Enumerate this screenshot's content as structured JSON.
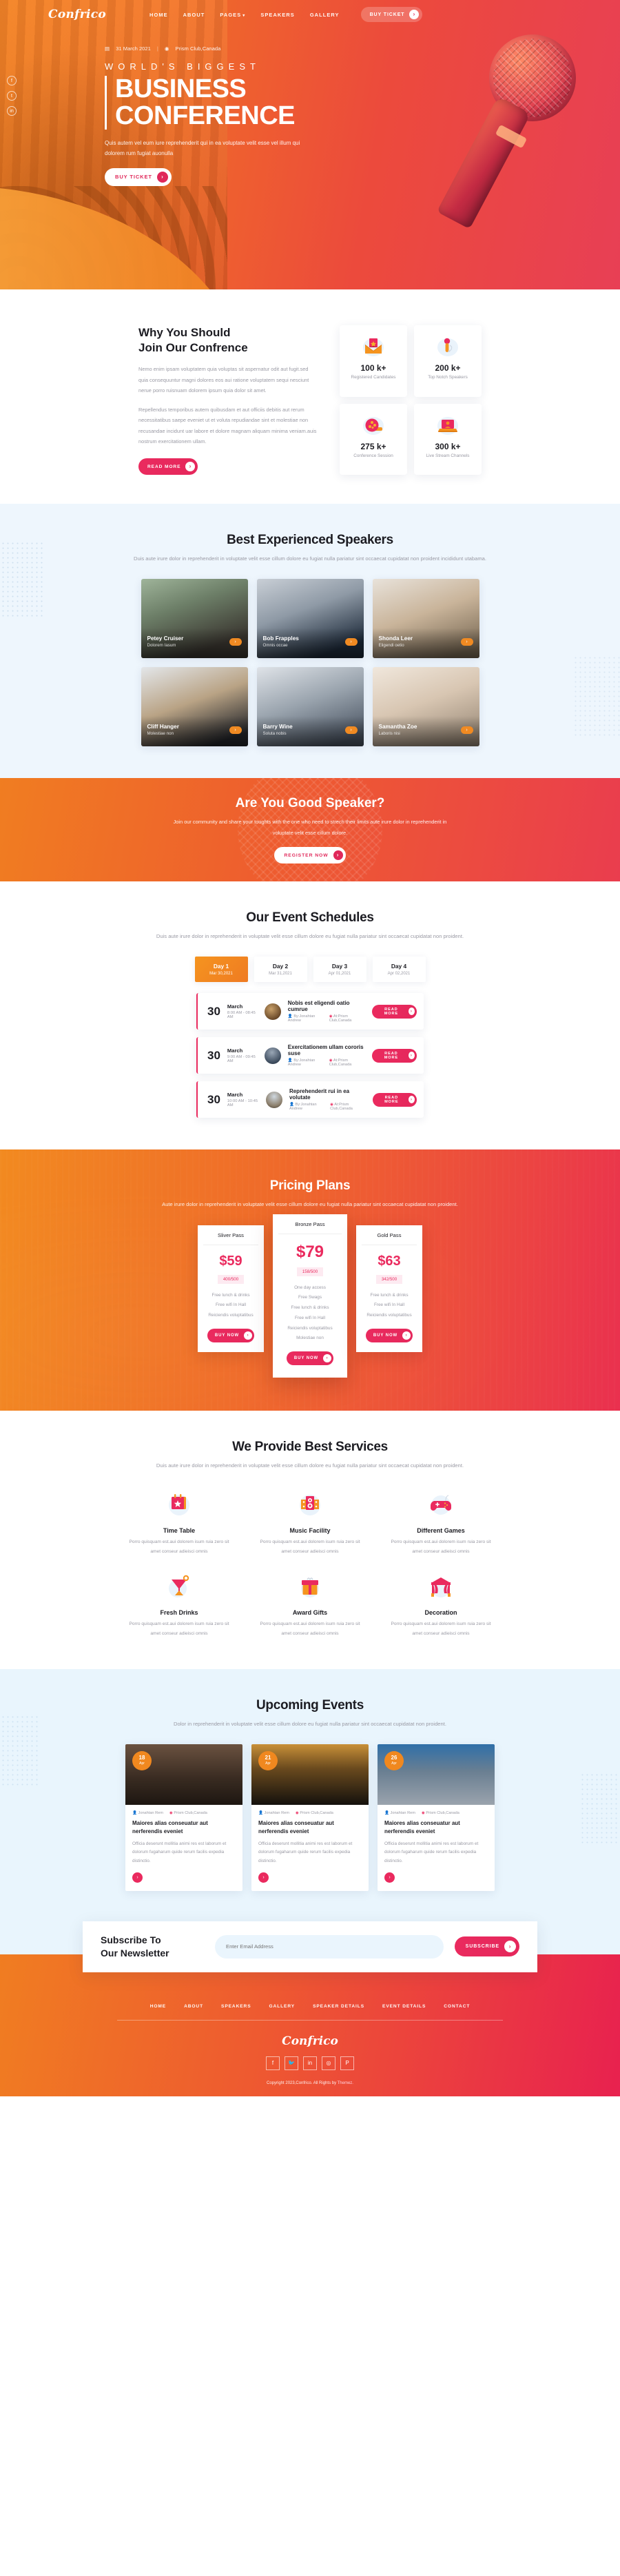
{
  "brand": {
    "name": "Confrico",
    "logo_icon": "confrico-script-logo"
  },
  "nav": {
    "items": [
      {
        "label": "HOME"
      },
      {
        "label": "ABOUT"
      },
      {
        "label": "PAGES"
      },
      {
        "label": "SPEAKERS"
      },
      {
        "label": "GALLERY"
      }
    ],
    "cta": {
      "label": "BUY TICKET",
      "icon": "chevron-right-icon"
    }
  },
  "hero": {
    "social": [
      {
        "icon": "facebook-icon",
        "glyph": "f"
      },
      {
        "icon": "twitter-icon",
        "glyph": "t"
      },
      {
        "icon": "instagram-icon",
        "glyph": "in"
      }
    ],
    "date": "31 March 2021",
    "date_icon": "calendar-icon",
    "location": "Prism Club,Canada",
    "location_icon": "map-pin-icon",
    "pretitle": "WORLD'S BIGGEST",
    "title_line1": "BUSINESS",
    "title_line2": "CONFERENCE",
    "description": "Quis autem vel eum iure reprehenderit qui in ea voluptate velit esse vel illum qui dolorem rum fugiat auonulla",
    "cta": {
      "label": "BUY TICKET",
      "icon": "chevron-right-icon"
    }
  },
  "why": {
    "title_line1": "Why You Should",
    "title_line2": "Join Our Confrence",
    "para1": "Nemo enim ipsam voluptatem quia voluptas sit aspernatur odit aut fugit.sed quia consequuntur magni dolores eos aui ratione voluptatem sequi nesciunt nerue porro ruisnuam dolorem ipsum quia dolor sit amet.",
    "para2": "Repellendus temporibus autem quibusdam et aut officiis debitis aut rerum necessitatibus saepe eveniet ut et voluta repudiandae sint et molestiae non recusandae incidunt uar labore et dolore magnam aliquam minima veniam.auis nostrum exercitationem ullam.",
    "cta": {
      "label": "READ MORE",
      "icon": "chevron-right-icon"
    },
    "stats": [
      {
        "number": "100 k+",
        "label": "Registered Candidates",
        "icon": "envelope-badge-icon"
      },
      {
        "number": "200 k+",
        "label": "Top Notch Speakers",
        "icon": "microphone-icon"
      },
      {
        "number": "275 k+",
        "label": "Conference Session",
        "icon": "film-reel-icon"
      },
      {
        "number": "300 k+",
        "label": "Live Stream Channels",
        "icon": "laptop-stream-icon"
      }
    ]
  },
  "speakers": {
    "title": "Best Experienced Speakers",
    "subtitle": "Duis aute irure dolor in reprehenderit in voluptate velit esse cillum dolore eu fugiat nulla pariatur sint occaecat cupidatat non proident incididunt utabama.",
    "items": [
      {
        "name": "Petey Cruiser",
        "role": "Dolorem Iasum",
        "icon": "chevron-right-icon"
      },
      {
        "name": "Bob Frapples",
        "role": "Omnis occae",
        "icon": "chevron-right-icon"
      },
      {
        "name": "Shonda Leer",
        "role": "Eligendi oetio",
        "icon": "chevron-right-icon"
      },
      {
        "name": "Cliff Hanger",
        "role": "Molestiae non",
        "icon": "chevron-right-icon"
      },
      {
        "name": "Barry Wine",
        "role": "Soluta nobis",
        "icon": "chevron-right-icon"
      },
      {
        "name": "Samantha Zoe",
        "role": "Laboris nisi",
        "icon": "chevron-right-icon"
      }
    ]
  },
  "cta_banner": {
    "title": "Are You Good Speaker?",
    "description": "Join our community and share your toughts with the one who need to strech their limits aute irure dolor in reprehenderit in voluptate velit esse cillum dolore.",
    "button": {
      "label": "REGISTER NOW",
      "icon": "chevron-right-icon"
    }
  },
  "schedule": {
    "title": "Our Event Schedules",
    "subtitle": "Duis aute irure dolor in reprehenderit in voluptate velit esse cillum dolore eu fugiat nulla pariatur sint occaecat cupidatat non proident.",
    "days": [
      {
        "label": "Day 1",
        "date": "Mar 30,2021",
        "active": true
      },
      {
        "label": "Day 2",
        "date": "Mar 31,2021",
        "active": false
      },
      {
        "label": "Day 3",
        "date": "Apr 01,2021",
        "active": false
      },
      {
        "label": "Day 4",
        "date": "Apr 02,2021",
        "active": false
      }
    ],
    "rows": [
      {
        "day": "30",
        "month": "March",
        "time": "8:00 AM - 08:45 AM",
        "title": "Nobis est eligendi oatio cumrue",
        "by": "By:Jonahtan Andrew",
        "at": "At:Prism Club,Canada",
        "button": "READ MORE"
      },
      {
        "day": "30",
        "month": "March",
        "time": "9:00 AM - 09:45 AM",
        "title": "Exercitationem ullam cororis suse",
        "by": "By:Jonahtan Andrew",
        "at": "At:Prism Club,Canada",
        "button": "READ MORE"
      },
      {
        "day": "30",
        "month": "March",
        "time": "10:00 AM - 10:45 AM",
        "title": "Reprehenderit rui in ea volutate",
        "by": "By:Jonahtan Andrew",
        "at": "At:Prism Club,Canada",
        "button": "READ MORE"
      }
    ]
  },
  "pricing": {
    "title": "Pricing Plans",
    "subtitle": "Aute irure dolor in reprehenderit in voluptate velit esse cillum dolore eu fugiat nulla pariatur sint occaecat cupidatat non proident.",
    "plans": [
      {
        "name": "Sliver Pass",
        "price": "$59",
        "seats": "400/500",
        "featured": false,
        "features": [
          "Free lunch & drinks",
          "Free wifi In Hall",
          "Reiciendis voluptatibus"
        ],
        "button": "BUY NOW"
      },
      {
        "name": "Bronze Pass",
        "price": "$79",
        "seats": "158/500",
        "featured": true,
        "features": [
          "One day access",
          "Free Swags",
          "Free lunch & drinks",
          "Free wifi In Hall",
          "Reiciendis voluptatibus",
          "Molestiae non"
        ],
        "button": "BUY NOW"
      },
      {
        "name": "Gold Pass",
        "price": "$63",
        "seats": "342/500",
        "featured": false,
        "features": [
          "Free lunch & drinks",
          "Free wifi In Hall",
          "Reiciendis voluptatibus"
        ],
        "button": "BUY NOW"
      }
    ]
  },
  "services": {
    "title": "We Provide Best Services",
    "subtitle": "Duis aute irure dolor in reprehenderit in voluptate velit esse cillum dolore eu fugiat nulla pariatur sint occaecat cupidatat non proident.",
    "body": "Porro quisquam est.aui dolorem isum ruia zero sit amet conseur adieisci omnis",
    "items": [
      {
        "title": "Time Table",
        "icon": "calendar-star-icon"
      },
      {
        "title": "Music Facility",
        "icon": "speakers-icon"
      },
      {
        "title": "Different Games",
        "icon": "gamepad-icon"
      },
      {
        "title": "Fresh Drinks",
        "icon": "cocktail-icon"
      },
      {
        "title": "Award Gifts",
        "icon": "gift-box-icon"
      },
      {
        "title": "Decoration",
        "icon": "tent-decoration-icon"
      }
    ]
  },
  "events": {
    "title": "Upcoming Events",
    "subtitle": "Dolor in reprehenderit in voluptate velit esse cillum dolore eu fugiat nulla pariatur sint occaecat cupidatat non proident.",
    "items": [
      {
        "day": "18",
        "month": "Apr",
        "author": "Jonahtan Rem",
        "place": "Prism Club,Canada",
        "title": "Maiores alias conseuatur aut nerferendis eveniet",
        "text": "Officia deserunt mollitia animi res est laborum et dolorum fugaharum quide rerum facilis expedia distinctio.",
        "icon": "chevron-right-icon"
      },
      {
        "day": "21",
        "month": "Apr",
        "author": "Jonahtan Rem",
        "place": "Prism Club,Canada",
        "title": "Maiores alias conseuatur aut nerferendis eveniet",
        "text": "Officia deserunt mollitia animi res est laborum et dolorum fugaharum quide rerum facilis expedia distinctio.",
        "icon": "chevron-right-icon"
      },
      {
        "day": "26",
        "month": "Apr",
        "author": "Jonahtan Rem",
        "place": "Prism Club,Canada",
        "title": "Maiores alias conseuatur aut nerferendis eveniet",
        "text": "Officia deserunt mollitia animi res est laborum et dolorum fugaharum quide rerum facilis expedia distinctio.",
        "icon": "chevron-right-icon"
      }
    ]
  },
  "newsletter": {
    "title_line1": "Subscribe To",
    "title_line2": "Our Newsletter",
    "placeholder": "Enter Email Address",
    "value": "",
    "button": {
      "label": "SUBSCRIBE",
      "icon": "chevron-right-icon"
    }
  },
  "footer": {
    "nav": [
      {
        "label": "HOME"
      },
      {
        "label": "ABOUT"
      },
      {
        "label": "SPEAKERS"
      },
      {
        "label": "GALLERY"
      },
      {
        "label": "SPEAKER DETAILS"
      },
      {
        "label": "EVENT DETAILS"
      },
      {
        "label": "CONTACT"
      }
    ],
    "logo": "Confrico",
    "social": [
      {
        "icon": "facebook-icon",
        "glyph": "f"
      },
      {
        "icon": "twitter-icon",
        "glyph": "🐦"
      },
      {
        "icon": "linkedin-icon",
        "glyph": "in"
      },
      {
        "icon": "instagram-icon",
        "glyph": "◎"
      },
      {
        "icon": "pinterest-icon",
        "glyph": "P"
      }
    ],
    "copyright": "Copyright 2023,Confrico. All Rights by ",
    "copyright_link": "Themez."
  },
  "colors": {
    "orange": "#f07d21",
    "red": "#ea3d4e",
    "pink": "#ea2a5e",
    "light_blue": "#eef6fd"
  }
}
